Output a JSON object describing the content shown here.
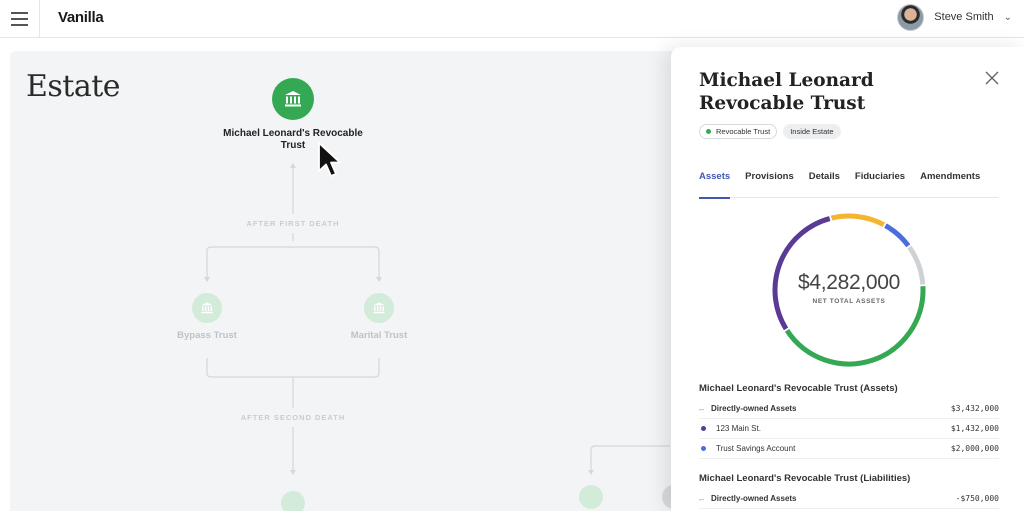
{
  "header": {
    "brand": "Vanilla",
    "user_name": "Steve Smith"
  },
  "canvas": {
    "title": "Estate",
    "main_node_label": "Michael Leonard's Revocable Trust",
    "after_first_death": "AFTER FIRST DEATH",
    "after_second_death": "AFTER SECOND DEATH",
    "bypass_trust": "Bypass Trust",
    "marital_trust": "Marital Trust"
  },
  "panel": {
    "title": "Michael Leonard Revocable Trust",
    "tags": [
      "Revocable Trust",
      "Inside Estate"
    ],
    "tabs": [
      "Assets",
      "Provisions",
      "Details",
      "Fiduciaries",
      "Amendments"
    ],
    "active_tab": "Assets",
    "total_value": "$4,282,000",
    "total_caption": "NET TOTAL ASSETS",
    "donut_segments": [
      {
        "color": "#34a853",
        "fraction": 0.42
      },
      {
        "color": "#5b3a96",
        "fraction": 0.3
      },
      {
        "color": "#f2b631",
        "fraction": 0.12
      },
      {
        "color": "#4a6fdc",
        "fraction": 0.07
      },
      {
        "color": "#cfd2d4",
        "fraction": 0.09
      }
    ],
    "assets_title": "Michael Leonard's Revocable Trust (Assets)",
    "assets": [
      {
        "marker": "–",
        "name": "Directly-owned Assets",
        "amount": "$3,432,000",
        "bold": true
      },
      {
        "color": "#5b3a96",
        "name": "123 Main St.",
        "amount": "$1,432,000",
        "bold": false
      },
      {
        "color": "#4a6fdc",
        "name": "Trust Savings Account",
        "amount": "$2,000,000",
        "bold": false
      }
    ],
    "liabilities_title": "Michael Leonard's Revocable Trust (Liabilities)",
    "liabilities": [
      {
        "marker": "–",
        "name": "Directly-owned Assets",
        "amount": "-$750,000",
        "bold": true
      }
    ]
  },
  "colors": {
    "accent": "#4257b2",
    "trust_green": "#34a853"
  }
}
